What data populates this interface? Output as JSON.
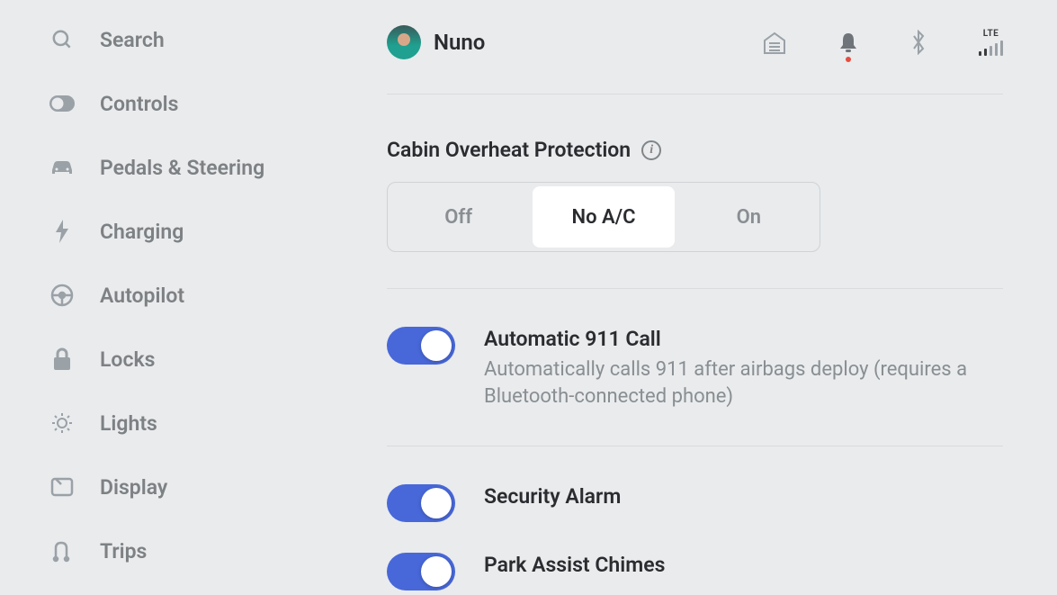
{
  "sidebar": {
    "items": [
      {
        "label": "Search"
      },
      {
        "label": "Controls"
      },
      {
        "label": "Pedals & Steering"
      },
      {
        "label": "Charging"
      },
      {
        "label": "Autopilot"
      },
      {
        "label": "Locks"
      },
      {
        "label": "Lights"
      },
      {
        "label": "Display"
      },
      {
        "label": "Trips"
      }
    ]
  },
  "profile": {
    "name": "Nuno"
  },
  "status": {
    "network": "LTE"
  },
  "overheat": {
    "title": "Cabin Overheat Protection",
    "options": {
      "off": "Off",
      "noac": "No A/C",
      "on": "On"
    },
    "selected": "noac"
  },
  "toggles": {
    "auto911": {
      "title": "Automatic 911 Call",
      "desc": "Automatically calls 911 after airbags deploy (requires a Bluetooth-connected phone)",
      "on": true
    },
    "security": {
      "title": "Security Alarm",
      "on": true
    },
    "parkAssist": {
      "title": "Park Assist Chimes",
      "on": true
    }
  }
}
